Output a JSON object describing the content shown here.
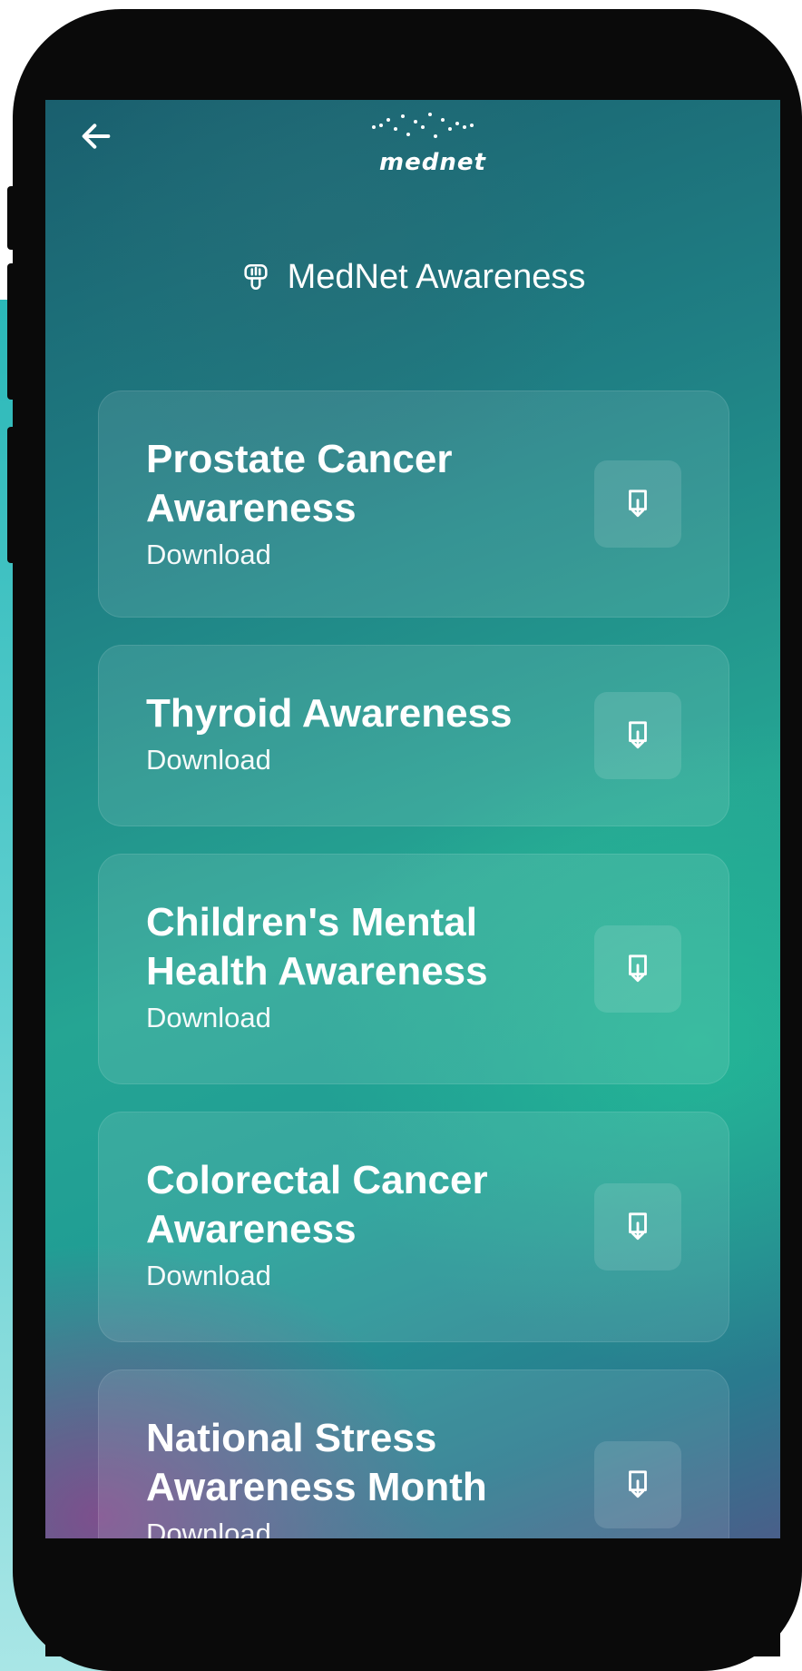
{
  "app": {
    "logo_text": "mednet",
    "logo_icon": "dotted-wave-icon"
  },
  "header": {
    "back_icon": "arrow-left-icon",
    "title": "MedNet Awareness",
    "title_icon": "brain-icon"
  },
  "cards": [
    {
      "title": "Prostate Cancer Awareness",
      "subtitle": "Download",
      "action_icon": "download-icon"
    },
    {
      "title": "Thyroid Awareness",
      "subtitle": "Download",
      "action_icon": "download-icon"
    },
    {
      "title": "Children's Mental Health Awareness",
      "subtitle": "Download",
      "action_icon": "download-icon"
    },
    {
      "title": "Colorectal Cancer Awareness",
      "subtitle": "Download",
      "action_icon": "download-icon"
    },
    {
      "title": "National Stress Awareness Month",
      "subtitle": "Download",
      "action_icon": "download-icon"
    }
  ],
  "colors": {
    "gradient_top": "#1a5f6e",
    "gradient_mid": "#25a593",
    "gradient_bottom_left": "#8c468c",
    "text": "#ffffff",
    "deco_teal": "#2bb8b8"
  }
}
